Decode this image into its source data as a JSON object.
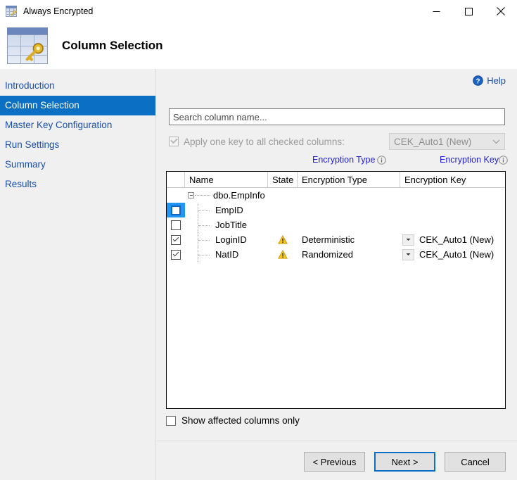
{
  "window": {
    "title": "Always Encrypted",
    "icon": "grid-key-icon",
    "controls": {
      "minimize": "minimize-icon",
      "maximize": "maximize-icon",
      "close": "close-icon"
    }
  },
  "header": {
    "icon": "grid-key-icon",
    "title": "Column Selection"
  },
  "sidebar": {
    "items": [
      {
        "label": "Introduction",
        "selected": false
      },
      {
        "label": "Column Selection",
        "selected": true
      },
      {
        "label": "Master Key Configuration",
        "selected": false
      },
      {
        "label": "Run Settings",
        "selected": false
      },
      {
        "label": "Summary",
        "selected": false
      },
      {
        "label": "Results",
        "selected": false
      }
    ]
  },
  "content": {
    "help": {
      "label": "Help",
      "icon": "help-circle-icon"
    },
    "search": {
      "placeholder": "Search column name...",
      "value": ""
    },
    "apply_key": {
      "label": "Apply one key to all checked columns:",
      "checked": true,
      "disabled": true,
      "selected_key": "CEK_Auto1 (New)"
    },
    "links": [
      {
        "label": "Encryption Type",
        "info_icon": "info-circle-icon"
      },
      {
        "label": "Encryption Key",
        "info_icon": "info-circle-icon"
      }
    ],
    "grid": {
      "columns": [
        "",
        "Name",
        "State",
        "Encryption Type",
        "Encryption Key"
      ],
      "rows": [
        {
          "type": "parent",
          "checkbox": "none",
          "name": "dbo.EmpInfo",
          "state": "",
          "encryption_type": "",
          "encryption_key": "",
          "selected": false
        },
        {
          "type": "child",
          "checkbox": "unchecked",
          "name": "EmpID",
          "state": "",
          "encryption_type": "",
          "encryption_key": "",
          "selected": true
        },
        {
          "type": "child",
          "checkbox": "unchecked",
          "name": "JobTitle",
          "state": "",
          "encryption_type": "",
          "encryption_key": "",
          "selected": false
        },
        {
          "type": "child",
          "checkbox": "checked",
          "name": "LoginID",
          "state": "warning-icon",
          "encryption_type": "Deterministic",
          "encryption_key": "CEK_Auto1 (New)",
          "selected": false
        },
        {
          "type": "child",
          "checkbox": "checked",
          "name": "NatID",
          "state": "warning-icon",
          "encryption_type": "Randomized",
          "encryption_key": "CEK_Auto1 (New)",
          "selected": false
        }
      ]
    },
    "show_affected": {
      "label": "Show affected columns only",
      "checked": false
    },
    "buttons": {
      "previous": "< Previous",
      "next": "Next >",
      "cancel": "Cancel"
    }
  },
  "colors": {
    "accent": "#0b6fc4",
    "link": "#1a4fb0",
    "grid_link": "#2020e0",
    "selection": "#2196f3",
    "warning": "#f3c11a",
    "panel": "#f0f0f0"
  }
}
